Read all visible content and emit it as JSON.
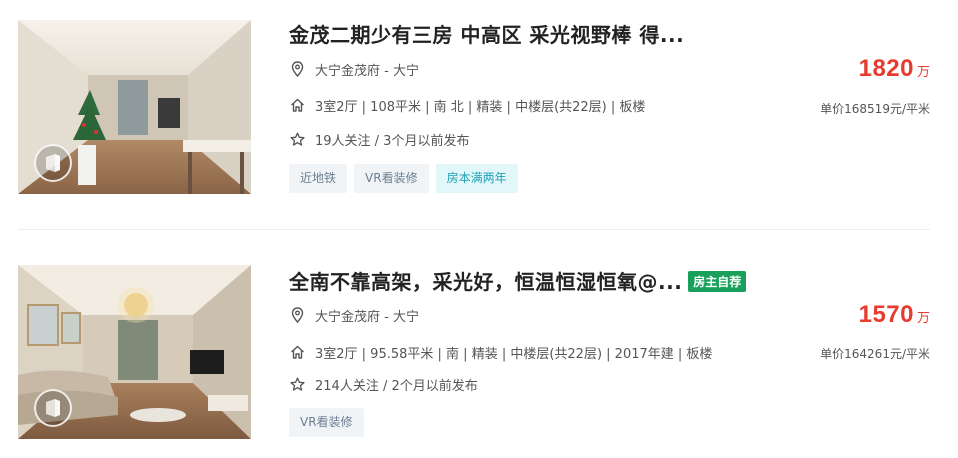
{
  "listings": [
    {
      "title": "金茂二期少有三房 中高区 采光视野棒 得...",
      "owner_tag": "",
      "location": "大宁金茂府 - 大宁",
      "attributes": "3室2厅 | 108平米 | 南 北 | 精装 | 中楼层(共22层) | 板楼",
      "follow": "19人关注 / 3个月以前发布",
      "tags": [
        {
          "label": "近地铁",
          "style": "gray"
        },
        {
          "label": "VR看装修",
          "style": "gray"
        },
        {
          "label": "房本满两年",
          "style": "cyan"
        }
      ],
      "price_value": "1820",
      "price_unit": "万",
      "unit_price": "单价168519元/平米"
    },
    {
      "title": "全南不靠高架，采光好，恒温恒湿恒氧@...",
      "owner_tag": "房主自荐",
      "location": "大宁金茂府 - 大宁",
      "attributes": "3室2厅 | 95.58平米 | 南 | 精装 | 中楼层(共22层) | 2017年建 | 板楼",
      "follow": "214人关注 / 2个月以前发布",
      "tags": [
        {
          "label": "VR看装修",
          "style": "gray"
        }
      ],
      "price_value": "1570",
      "price_unit": "万",
      "unit_price": "单价164261元/平米"
    }
  ],
  "icons": {
    "location": "location-pin-icon",
    "house": "house-icon",
    "star": "star-icon",
    "vr": "vr-panorama-icon"
  },
  "colors": {
    "price": "#e83b2f",
    "owner_tag_bg": "#19a05a",
    "tag_gray_bg": "#f1f4f7",
    "tag_gray_text": "#6b7f91",
    "tag_cyan_bg": "#e2f7fa",
    "tag_cyan_text": "#1fa2b6"
  }
}
